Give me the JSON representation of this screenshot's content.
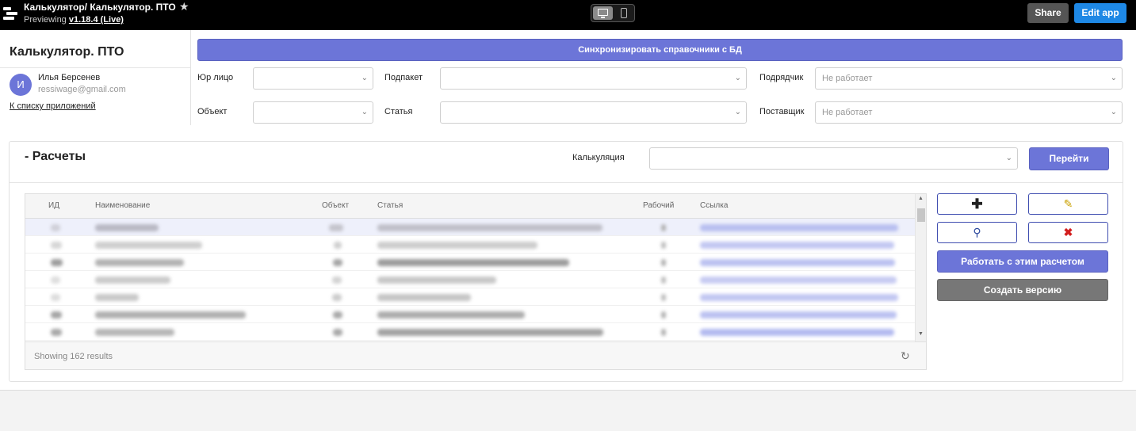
{
  "topbar": {
    "title": "Калькулятор/ Калькулятор. ПТО",
    "preview_prefix": "Previewing",
    "version": "v1.18.4 (Live)",
    "share_label": "Share",
    "edit_label": "Edit app"
  },
  "sidebar": {
    "app_name": "Калькулятор. ПТО",
    "avatar_letter": "И",
    "user_name": "Илья Берсенев",
    "user_email": "ressiwage@gmail.com",
    "back_link": "К списку приложений"
  },
  "filters": {
    "sync_button": "Синхронизировать справочники с БД",
    "legal_entity": {
      "label": "Юр лицо",
      "value": ""
    },
    "subpackage": {
      "label": "Подпакет",
      "value": ""
    },
    "contractor": {
      "label": "Подрядчик",
      "placeholder": "Не работает"
    },
    "object": {
      "label": "Объект",
      "value": ""
    },
    "article": {
      "label": "Статья",
      "value": ""
    },
    "supplier": {
      "label": "Поставщик",
      "placeholder": "Не работает"
    }
  },
  "panel": {
    "title": "- Расчеты",
    "calc_label": "Калькуляция",
    "calc_value": "",
    "go_button": "Перейти"
  },
  "table": {
    "columns": [
      "ИД",
      "Наименование",
      "Объект",
      "Статья",
      "Рабочий",
      "Ссылка"
    ],
    "footer": "Showing 162 results"
  },
  "actions": {
    "add_icon": "plus-icon",
    "edit_icon": "pencil-icon",
    "search_icon": "magnifier-icon",
    "delete_icon": "cross-icon",
    "work_button": "Работать с этим расчетом",
    "version_button": "Создать версию"
  },
  "colors": {
    "accent": "#6c75d8",
    "edit_app": "#1e88e5",
    "delete": "#d21e1e"
  }
}
